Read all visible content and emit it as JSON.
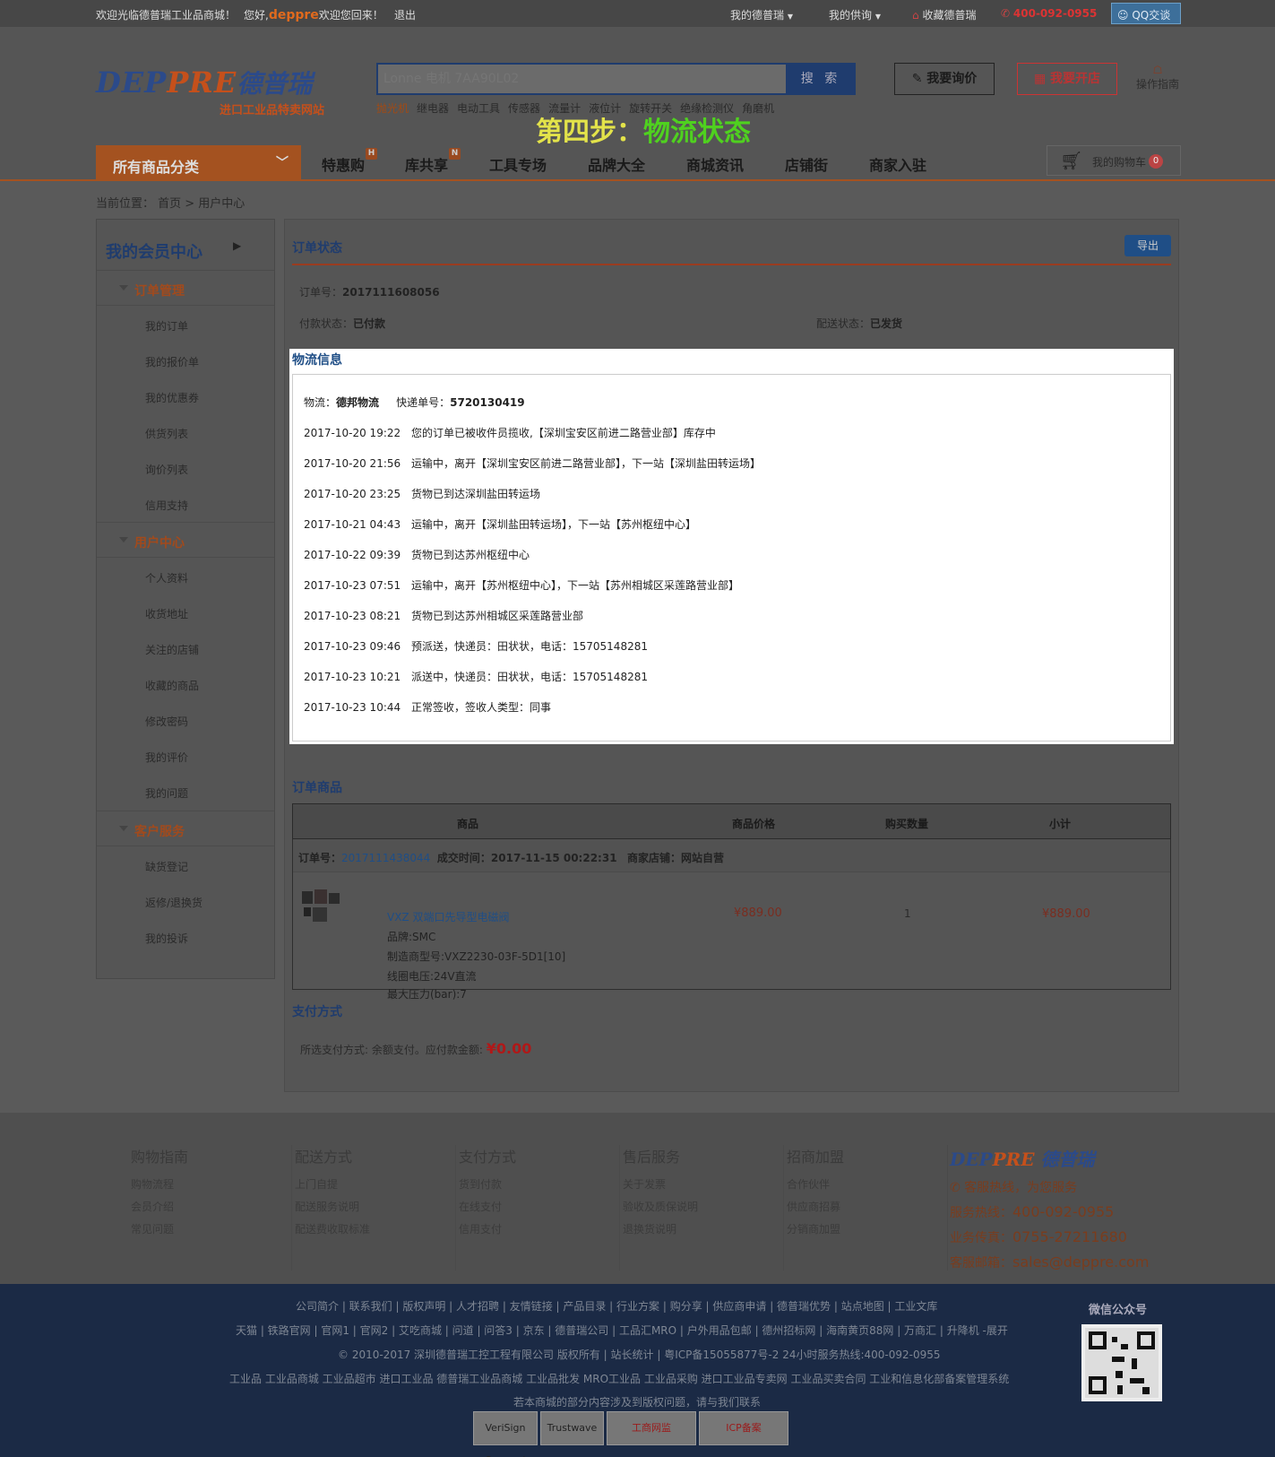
{
  "topbar": {
    "welcome": "欢迎光临德普瑞工业品商城！",
    "hello_prefix": "您好,",
    "username": "deppre",
    "hello_suffix": "欢迎您回来！",
    "logout": "退出",
    "my_deppre": "我的德普瑞",
    "my_supply": "我的供询",
    "favorite": "收藏德普瑞",
    "phone": "400-092-0955",
    "qq": "QQ交谈"
  },
  "header": {
    "logo_en_a": "DEP",
    "logo_en_b": "PRE",
    "logo_cn": "德普瑞",
    "logo_sub": "进口工业品特卖网站",
    "search_placeholder": "Lonne 电机 7AA90L02",
    "search_button": "搜 索",
    "hotwords": [
      "抛光机",
      "继电器",
      "电动工具",
      "传感器",
      "流量计",
      "液位计",
      "旋转开关",
      "绝缘检测仪",
      "角磨机"
    ],
    "inquiry_button": "我要询价",
    "open_shop_button": "我要开店",
    "guide": "操作指南",
    "step_a": "第四步：",
    "step_b": "物流状态"
  },
  "nav": {
    "all_categories": "所有商品分类",
    "items": [
      {
        "label": "特惠购",
        "badge": "H"
      },
      {
        "label": "库共享",
        "badge": "N"
      },
      {
        "label": "工具专场",
        "badge": ""
      },
      {
        "label": "品牌大全",
        "badge": ""
      },
      {
        "label": "商城资讯",
        "badge": ""
      },
      {
        "label": "店铺街",
        "badge": ""
      },
      {
        "label": "商家入驻",
        "badge": ""
      }
    ],
    "cart_label": "我的购物车",
    "cart_count": "0"
  },
  "breadcrumb": "当前位置： 首页 > 用户中心",
  "sidebar": {
    "title": "我的会员中心",
    "sections": [
      {
        "label": "订单管理",
        "items": [
          "我的订单",
          "我的报价单",
          "我的优惠券",
          "供货列表",
          "询价列表",
          "信用支持"
        ]
      },
      {
        "label": "用户中心",
        "items": [
          "个人资料",
          "收货地址",
          "关注的店铺",
          "收藏的商品",
          "修改密码",
          "我的评价",
          "我的问题"
        ]
      },
      {
        "label": "客户服务",
        "items": [
          "缺货登记",
          "返修/退换货",
          "我的投诉"
        ]
      }
    ]
  },
  "order_status": {
    "title": "订单状态",
    "export": "导出",
    "order_no_label": "订单号：",
    "order_no": "2017111608056",
    "pay_status_label": "付款状态：",
    "pay_status": "已付款",
    "ship_status_label": "配送状态：",
    "ship_status": "已发货"
  },
  "logistics": {
    "title": "物流信息",
    "carrier_label": "物流：",
    "carrier": "德邦物流",
    "tracking_label": "快递单号：",
    "tracking_no": "5720130419",
    "events": [
      {
        "time": "2017-10-20 19:22",
        "text": "您的订单已被收件员揽收,【深圳宝安区前进二路营业部】库存中"
      },
      {
        "time": "2017-10-20 21:56",
        "text": "运输中，离开【深圳宝安区前进二路营业部】，下一站【深圳盐田转运场】"
      },
      {
        "time": "2017-10-20 23:25",
        "text": "货物已到达深圳盐田转运场"
      },
      {
        "time": "2017-10-21 04:43",
        "text": "运输中，离开【深圳盐田转运场】，下一站【苏州枢纽中心】"
      },
      {
        "time": "2017-10-22 09:39",
        "text": "货物已到达苏州枢纽中心"
      },
      {
        "time": "2017-10-23 07:51",
        "text": "运输中，离开【苏州枢纽中心】，下一站【苏州相城区采莲路营业部】"
      },
      {
        "time": "2017-10-23 08:21",
        "text": "货物已到达苏州相城区采莲路营业部"
      },
      {
        "time": "2017-10-23 09:46",
        "text": "预派送，快递员：田状状，电话：15705148281"
      },
      {
        "time": "2017-10-23 10:21",
        "text": "派送中，快递员：田状状，电话：15705148281"
      },
      {
        "time": "2017-10-23 10:44",
        "text": "正常签收，签收人类型：同事"
      }
    ]
  },
  "order_goods": {
    "title": "订单商品",
    "headers": [
      "商品",
      "商品价格",
      "购买数量",
      "小计"
    ],
    "sub_order_label": "订单号：",
    "sub_order_no": "2017111438044",
    "deal_time": "成交时间：2017-11-15 00:22:31",
    "shop": "商家店铺：网站自营",
    "product": {
      "name": "VXZ 双端口先导型电磁阀",
      "brand": "品牌:SMC",
      "model": "制造商型号:VXZ2230-03F-5D1[10]",
      "voltage": "线圈电压:24V直流",
      "pressure": "最大压力(bar):7",
      "price": "¥889.00",
      "qty": "1",
      "subtotal": "¥889.00"
    }
  },
  "payment": {
    "title": "支付方式",
    "text": "所选支付方式: 余额支付。应付款金额:",
    "amount": "¥0.00"
  },
  "footer": {
    "columns": [
      {
        "title": "购物指南",
        "items": [
          "购物流程",
          "会员介绍",
          "常见问题"
        ]
      },
      {
        "title": "配送方式",
        "items": [
          "上门自提",
          "配送服务说明",
          "配送费收取标准"
        ]
      },
      {
        "title": "支付方式",
        "items": [
          "货到付款",
          "在线支付",
          "信用支付"
        ]
      },
      {
        "title": "售后服务",
        "items": [
          "关于发票",
          "验收及质保说明",
          "退换货说明"
        ]
      },
      {
        "title": "招商加盟",
        "items": [
          "合作伙伴",
          "供应商招募",
          "分销商加盟"
        ]
      }
    ],
    "contact": {
      "logo_a": "DEP",
      "logo_b": "PRE",
      "logo_cn": "德普瑞",
      "slogan": "客服热线，为您服务",
      "hotline_label": "服务热线：",
      "hotline": "400-092-0955",
      "fax_label": "业务传真：",
      "fax": "0755-27211680",
      "email_label": "客服邮箱：",
      "email": "sales@deppre.com"
    },
    "links1": "公司简介 | 联系我们 | 版权声明 | 人才招聘 | 友情链接 | 产品目录 | 行业方案 | 购分享 | 供应商申请 | 德普瑞优势 | 站点地图 | 工业文库",
    "links2": "天猫 | 铁路官网 | 官网1 | 官网2 | 艾吃商城 | 问道 | 问答3 | 京东 | 德普瑞公司 | 工品汇MRO | 户外用品包邮 | 德州招标网 | 海南黄页88网 | 万商汇 | 升降机  -展开",
    "copyright": "© 2010-2017 深圳德普瑞工控工程有限公司 版权所有 | 站长统计 | 粤ICP备15055877号-2    24小时服务热线:400-092-0955",
    "links3": "工业品   工业品商城   工业品超市   进口工业品   德普瑞工业品商城   工业品批发   MRO工业品   工业品采购   进口工业品专卖网   工业品买卖合同   工业和信息化部备案管理系统",
    "notice": "若本商城的部分内容涉及到版权问题，请与我们联系",
    "wechat": "微信公众号",
    "badges": [
      "VeriSign Secured",
      "Trustwave",
      "工商网监",
      "ICP备案"
    ]
  }
}
